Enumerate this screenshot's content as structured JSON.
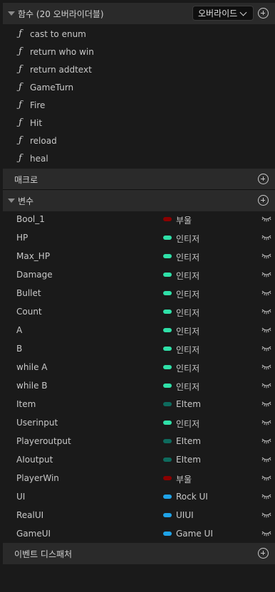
{
  "functions": {
    "title": "함수 (20 오버라이더블)",
    "override_label": "오버라이드",
    "items": [
      {
        "label": "cast to enum"
      },
      {
        "label": "return who win"
      },
      {
        "label": "return addtext"
      },
      {
        "label": "GameTurn"
      },
      {
        "label": "Fire"
      },
      {
        "label": "Hit"
      },
      {
        "label": "reload"
      },
      {
        "label": "heal"
      }
    ]
  },
  "macros": {
    "title": "매크로"
  },
  "variables": {
    "title": "변수",
    "items": [
      {
        "name": "Bool_1",
        "type": "부울",
        "color": "#8b0000"
      },
      {
        "name": "HP",
        "type": "인티저",
        "color": "#2fe0a8"
      },
      {
        "name": "Max_HP",
        "type": "인티저",
        "color": "#2fe0a8"
      },
      {
        "name": "Damage",
        "type": "인티저",
        "color": "#2fe0a8"
      },
      {
        "name": "Bullet",
        "type": "인티저",
        "color": "#2fe0a8"
      },
      {
        "name": "Count",
        "type": "인티저",
        "color": "#2fe0a8"
      },
      {
        "name": "A",
        "type": "인티저",
        "color": "#2fe0a8"
      },
      {
        "name": "B",
        "type": "인티저",
        "color": "#2fe0a8"
      },
      {
        "name": "while A",
        "type": "인티저",
        "color": "#2fe0a8"
      },
      {
        "name": "while B",
        "type": "인티저",
        "color": "#2fe0a8"
      },
      {
        "name": "Item",
        "type": "EItem",
        "color": "#0e6b5e"
      },
      {
        "name": "Userinput",
        "type": "인티저",
        "color": "#2fe0a8"
      },
      {
        "name": "Playeroutput",
        "type": "EItem",
        "color": "#0e6b5e"
      },
      {
        "name": "AIoutput",
        "type": "EItem",
        "color": "#0e6b5e"
      },
      {
        "name": "PlayerWin",
        "type": "부울",
        "color": "#8b0000"
      },
      {
        "name": "UI",
        "type": "Rock UI",
        "color": "#1fa3e8"
      },
      {
        "name": "RealUI",
        "type": "UIUI",
        "color": "#1fa3e8"
      },
      {
        "name": "GameUI",
        "type": "Game UI",
        "color": "#1fa3e8"
      }
    ]
  },
  "event_dispatchers": {
    "title": "이벤트 디스패처"
  }
}
